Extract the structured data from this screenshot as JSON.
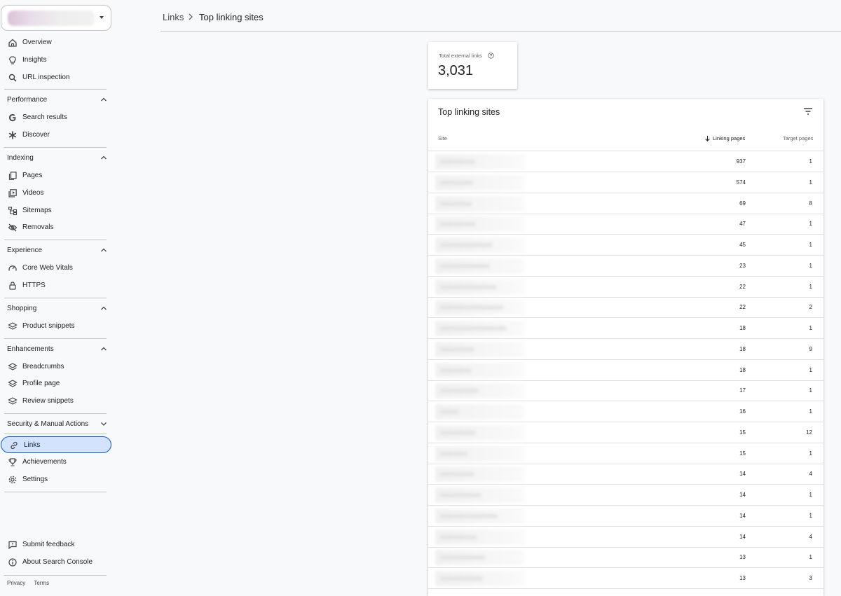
{
  "colors": {
    "accent": "#0b57d0",
    "active_bg": "#d3e3fd",
    "divider": "#c4c7c5"
  },
  "sidebar": {
    "property_selector": {
      "icon": "chevron-down-icon"
    },
    "top_items": [
      {
        "label": "Overview",
        "icon": "home-icon"
      },
      {
        "label": "Insights",
        "icon": "lightbulb-icon"
      },
      {
        "label": "URL inspection",
        "icon": "search-icon"
      }
    ],
    "sections": [
      {
        "title": "Performance",
        "expanded": true,
        "items": [
          {
            "label": "Search results",
            "icon": "google-g-icon"
          },
          {
            "label": "Discover",
            "icon": "asterisk-icon"
          }
        ]
      },
      {
        "title": "Indexing",
        "expanded": true,
        "items": [
          {
            "label": "Pages",
            "icon": "pages-icon"
          },
          {
            "label": "Videos",
            "icon": "video-icon"
          },
          {
            "label": "Sitemaps",
            "icon": "sitemap-icon"
          },
          {
            "label": "Removals",
            "icon": "eye-off-icon"
          }
        ]
      },
      {
        "title": "Experience",
        "expanded": true,
        "items": [
          {
            "label": "Core Web Vitals",
            "icon": "gauge-icon"
          },
          {
            "label": "HTTPS",
            "icon": "lock-icon"
          }
        ]
      },
      {
        "title": "Shopping",
        "expanded": true,
        "items": [
          {
            "label": "Product snippets",
            "icon": "layers-icon"
          }
        ]
      },
      {
        "title": "Enhancements",
        "expanded": true,
        "items": [
          {
            "label": "Breadcrumbs",
            "icon": "layers-icon"
          },
          {
            "label": "Profile page",
            "icon": "layers-icon"
          },
          {
            "label": "Review snippets",
            "icon": "layers-icon"
          }
        ]
      },
      {
        "title": "Security & Manual Actions",
        "expanded": false,
        "items": []
      }
    ],
    "bottom_items": [
      {
        "label": "Links",
        "icon": "link-icon",
        "active": true
      },
      {
        "label": "Achievements",
        "icon": "trophy-icon"
      },
      {
        "label": "Settings",
        "icon": "gear-icon"
      }
    ],
    "footer_items": [
      {
        "label": "Submit feedback",
        "icon": "feedback-icon"
      },
      {
        "label": "About Search Console",
        "icon": "info-icon"
      }
    ],
    "legal": {
      "privacy": "Privacy",
      "terms": "Terms"
    }
  },
  "breadcrumb": {
    "parent": "Links",
    "current": "Top linking sites"
  },
  "stat": {
    "label": "Total external links",
    "value": "3,031"
  },
  "table": {
    "title": "Top linking sites",
    "columns": {
      "site": "Site",
      "linking_pages": "Linking pages",
      "target_pages": "Target pages"
    },
    "sort_column": "linking_pages",
    "rows": [
      {
        "linking_pages": "937",
        "target_pages": "1"
      },
      {
        "linking_pages": "574",
        "target_pages": "1"
      },
      {
        "linking_pages": "69",
        "target_pages": "8"
      },
      {
        "linking_pages": "47",
        "target_pages": "1"
      },
      {
        "linking_pages": "45",
        "target_pages": "1"
      },
      {
        "linking_pages": "23",
        "target_pages": "1"
      },
      {
        "linking_pages": "22",
        "target_pages": "1"
      },
      {
        "linking_pages": "22",
        "target_pages": "2"
      },
      {
        "linking_pages": "18",
        "target_pages": "1"
      },
      {
        "linking_pages": "18",
        "target_pages": "9"
      },
      {
        "linking_pages": "18",
        "target_pages": "1"
      },
      {
        "linking_pages": "17",
        "target_pages": "1"
      },
      {
        "linking_pages": "16",
        "target_pages": "1"
      },
      {
        "linking_pages": "15",
        "target_pages": "12"
      },
      {
        "linking_pages": "15",
        "target_pages": "1"
      },
      {
        "linking_pages": "14",
        "target_pages": "4"
      },
      {
        "linking_pages": "14",
        "target_pages": "1"
      },
      {
        "linking_pages": "14",
        "target_pages": "1"
      },
      {
        "linking_pages": "14",
        "target_pages": "4"
      },
      {
        "linking_pages": "13",
        "target_pages": "1"
      },
      {
        "linking_pages": "13",
        "target_pages": "3"
      }
    ]
  }
}
